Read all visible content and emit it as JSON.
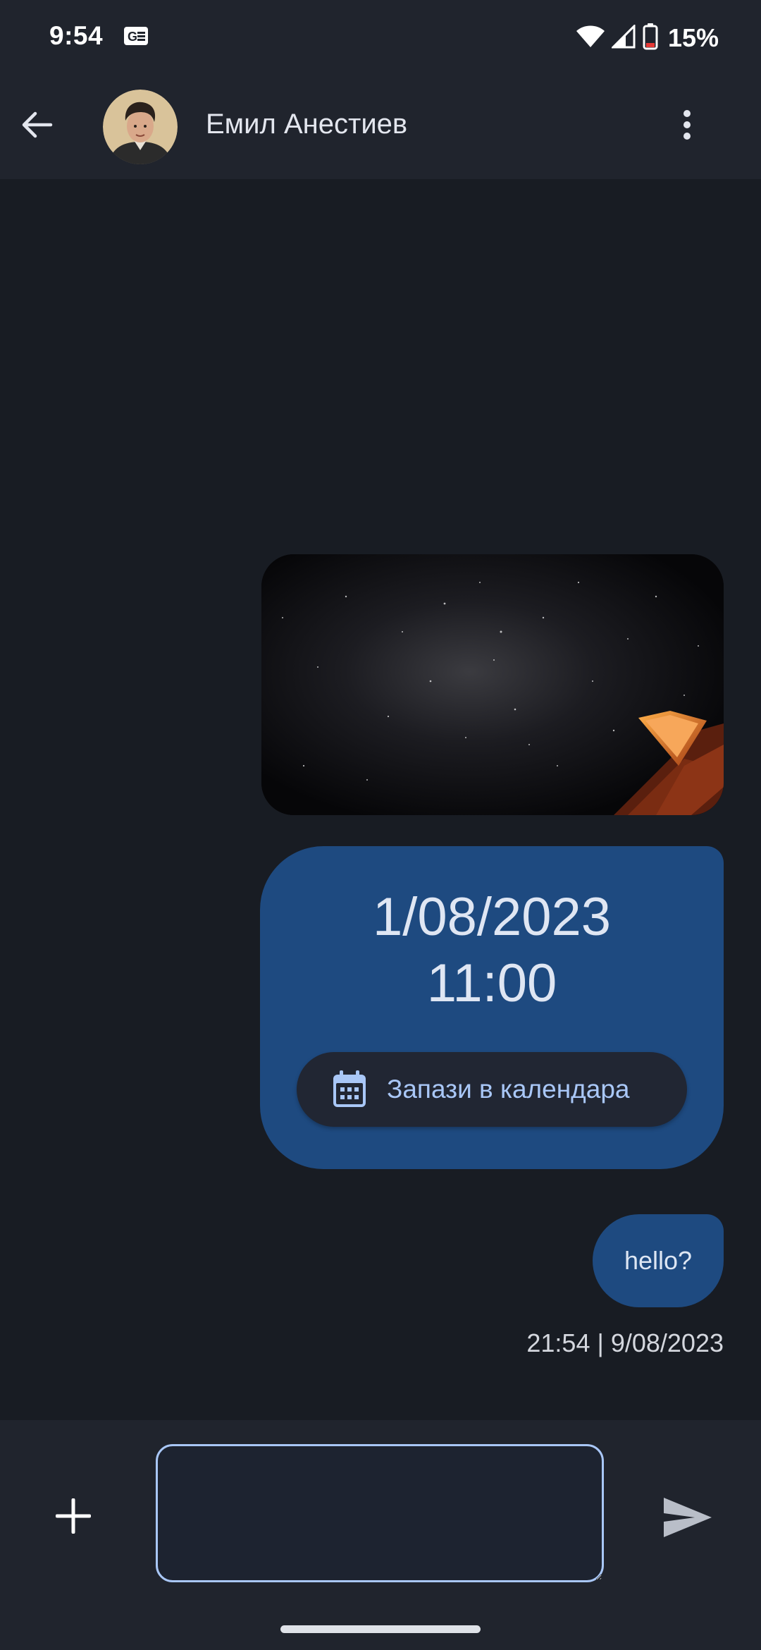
{
  "status_bar": {
    "time": "9:54",
    "battery": "15%",
    "icons": [
      "notification-card-icon",
      "wifi-icon",
      "cellular-signal-icon",
      "battery-low-icon"
    ]
  },
  "header": {
    "contact_name": "Емил Анестиев",
    "back_icon": "arrow-back-icon",
    "menu_icon": "more-vert-icon"
  },
  "messages": [
    {
      "type": "image",
      "description_icon": "night-sky-photo"
    },
    {
      "type": "datetime",
      "date": "1/08/2023",
      "time": "11:00",
      "action_label": "Запази в календара",
      "action_icon": "calendar-icon"
    },
    {
      "type": "text",
      "text": "hello?"
    }
  ],
  "last_timestamp": "21:54 | 9/08/2023",
  "composer": {
    "value": "",
    "placeholder": "",
    "add_icon": "plus-icon",
    "send_icon": "send-icon"
  },
  "colors": {
    "background": "#181c23",
    "bars": "#20242d",
    "outgoing_bubble": "#1e4a80",
    "accent": "#a9c7f7",
    "battery_low": "#e53935"
  }
}
